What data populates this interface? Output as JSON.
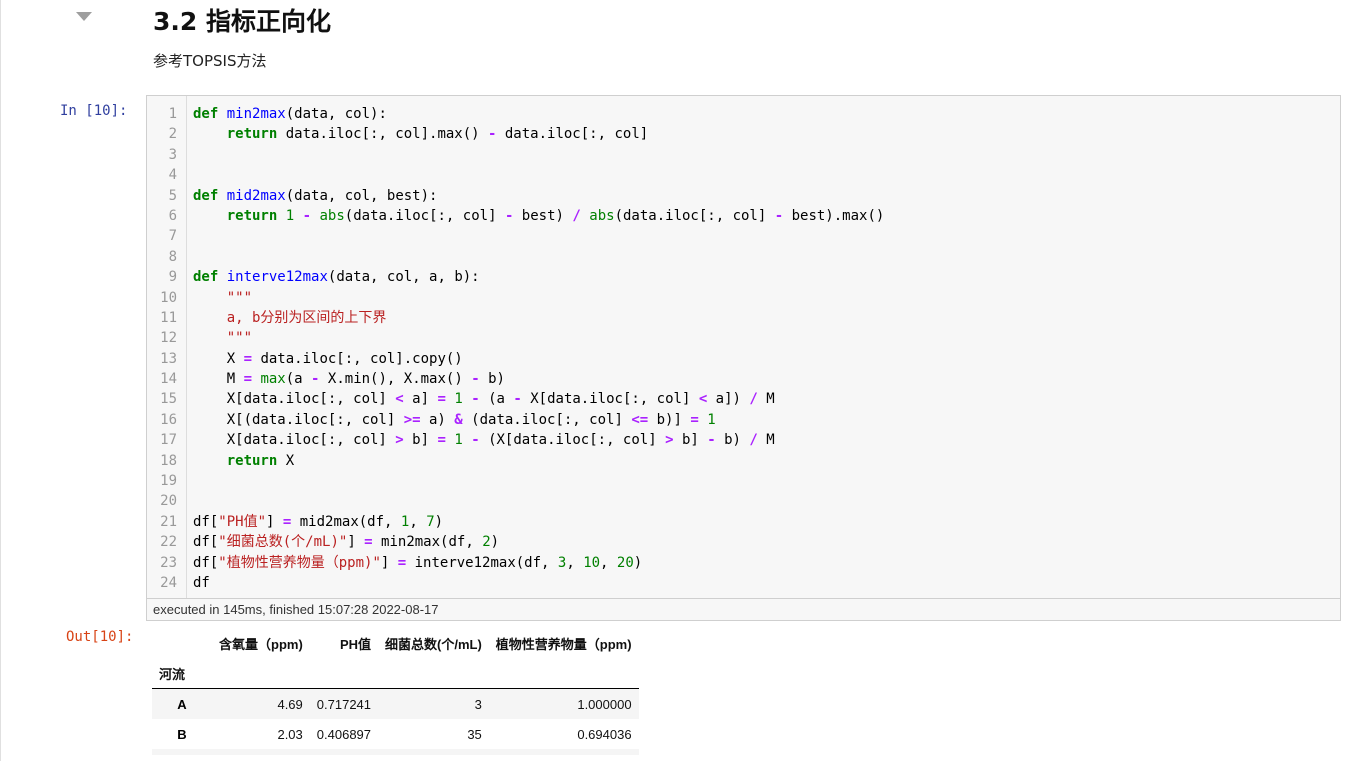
{
  "markdown": {
    "heading": "3.2  指标正向化",
    "subtitle": "参考TOPSIS方法"
  },
  "cell": {
    "in_prompt": "In  [10]:",
    "out_prompt": "Out[10]:",
    "exec_info": "executed in 145ms, finished 15:07:28 2022-08-17",
    "line_numbers": [
      "1",
      "2",
      "3",
      "4",
      "5",
      "6",
      "7",
      "8",
      "9",
      "10",
      "11",
      "12",
      "13",
      "14",
      "15",
      "16",
      "17",
      "18",
      "19",
      "20",
      "21",
      "22",
      "23",
      "24"
    ]
  },
  "output_table": {
    "columns": [
      "含氧量（ppm)",
      "PH值",
      "细菌总数(个/mL)",
      "植物性营养物量（ppm)"
    ],
    "index_name": "河流",
    "rows": [
      {
        "index": "A",
        "values": [
          "4.69",
          "0.717241",
          "3",
          "1.000000"
        ]
      },
      {
        "index": "B",
        "values": [
          "2.03",
          "0.406897",
          "35",
          "0.694036"
        ]
      }
    ]
  },
  "colors": {
    "keyword": "#008000",
    "function_name": "#0000ff",
    "operator": "#aa22ff",
    "string": "#ba2121",
    "in_prompt": "#303f9f",
    "out_prompt": "#d84315",
    "cell_background": "#f7f7f7"
  },
  "icons": {
    "collapse": "caret-down-icon"
  }
}
